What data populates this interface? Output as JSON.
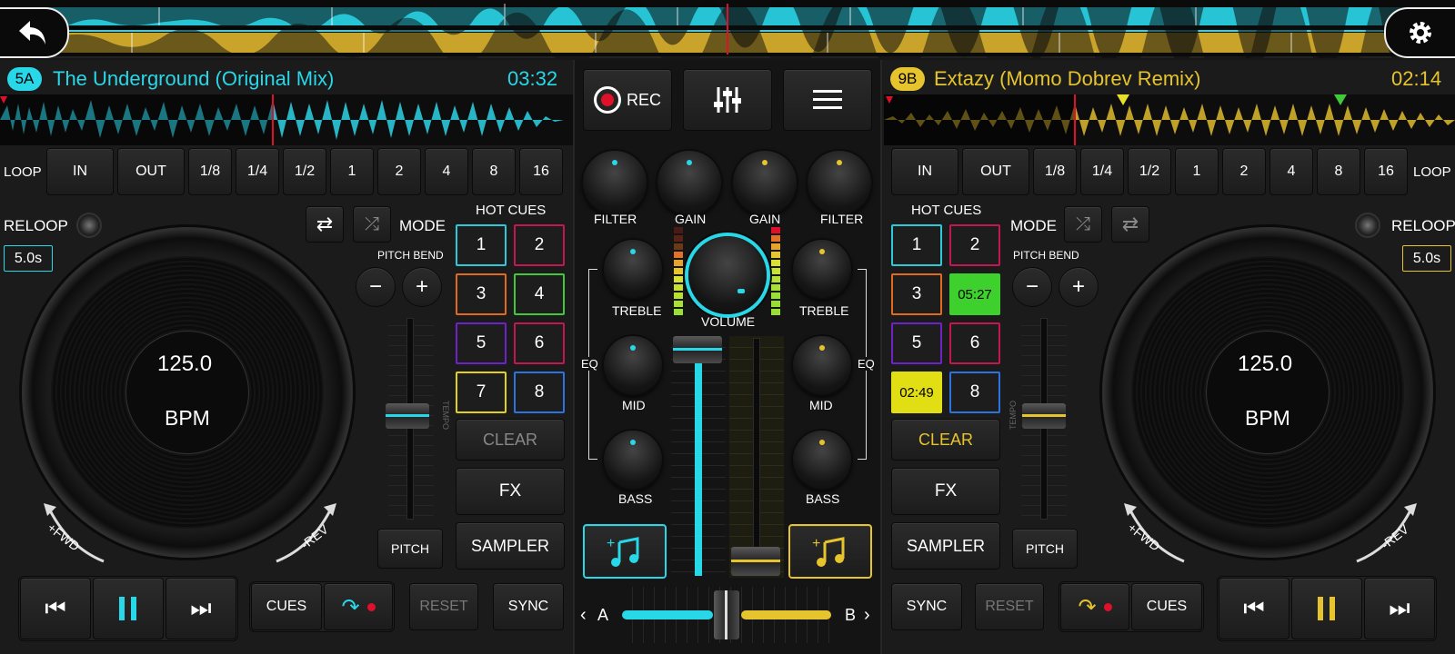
{
  "colors": {
    "deck_a": "#28d7e8",
    "deck_b": "#e6c42e",
    "rec": "#e0102a"
  },
  "top": {
    "back_icon": "back-arrow-icon",
    "settings_icon": "gear-icon"
  },
  "deck_a": {
    "key": "5A",
    "title": "The Underground (Original Mix)",
    "time": "03:32",
    "bpm": "125.0",
    "bpm_label": "BPM",
    "reloop_time": "5.0s"
  },
  "deck_b": {
    "key": "9B",
    "title": "Extazy (Momo Dobrev Remix)",
    "time": "02:14",
    "bpm": "125.0",
    "bpm_label": "BPM",
    "reloop_time": "5.0s"
  },
  "loop": {
    "label": "LOOP",
    "in": "IN",
    "out": "OUT",
    "sizes": [
      "1/8",
      "1/4",
      "1/2",
      "1",
      "2",
      "4",
      "8",
      "16"
    ]
  },
  "labels": {
    "reloop": "RELOOP",
    "mode": "MODE",
    "hot_cues": "HOT CUES",
    "pitch_bend": "PITCH BEND",
    "tempo": "TEMPO",
    "pitch": "PITCH",
    "clear": "CLEAR",
    "fx": "FX",
    "sampler": "SAMPLER",
    "cues": "CUES",
    "reset": "RESET",
    "sync": "SYNC",
    "fwd": "+FWD",
    "rev": "-REV",
    "minus": "−",
    "plus": "+"
  },
  "hotcues_a": [
    "1",
    "2",
    "3",
    "4",
    "5",
    "6",
    "7",
    "8"
  ],
  "hotcues_b": [
    "1",
    "2",
    "3",
    "05:27",
    "5",
    "6",
    "02:49",
    "8"
  ],
  "mixer": {
    "rec": "REC",
    "filter": "FILTER",
    "gain": "GAIN",
    "treble": "TREBLE",
    "mid": "MID",
    "bass": "BASS",
    "volume": "VOLUME",
    "eq": "EQ",
    "xfader_a": "A",
    "xfader_b": "B",
    "crossfader_position": 0.5
  }
}
